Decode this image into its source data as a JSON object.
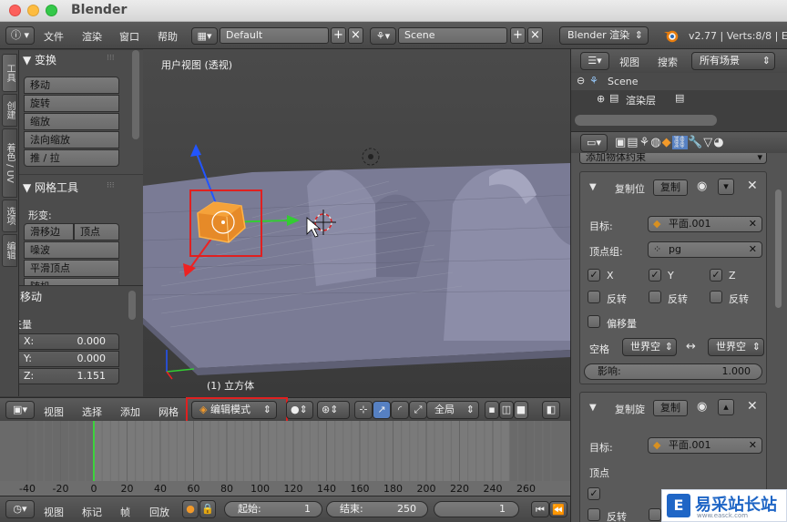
{
  "window": {
    "title": "Blender"
  },
  "topbar": {
    "menus": [
      "文件",
      "渲染",
      "窗口",
      "帮助"
    ],
    "layout": "Default",
    "scene": "Scene",
    "engine": "Blender 渲染",
    "stats": "v2.77 | Verts:8/8 | Ed"
  },
  "tabs": [
    "工具",
    "创建",
    "着色 / UV",
    "选项",
    "编辑"
  ],
  "shelf": {
    "transform_title": "变换",
    "transform_tools": [
      "移动",
      "旋转",
      "缩放",
      "法向缩放",
      "推 / 拉"
    ],
    "mesh_title": "网格工具",
    "deform_label": "形变:",
    "mesh_row1_a": "滑移边",
    "mesh_row1_b": "顶点",
    "mesh_tools": [
      "噪波",
      "平滑顶点",
      "随机"
    ],
    "op_title": "移动",
    "vector_label": "矢量",
    "x_label": "X:",
    "x_value": "0.000",
    "y_label": "Y:",
    "y_value": "0.000",
    "z_label": "Z:",
    "z_value": "1.151"
  },
  "viewport": {
    "view_label": "用户视图 (透视)",
    "object_label": "(1) 立方体"
  },
  "viewport_header": {
    "menus": [
      "视图",
      "选择",
      "添加",
      "网格"
    ],
    "mode": "编辑模式",
    "pivot": "全局"
  },
  "timeline": {
    "ruler": [
      "-40",
      "-20",
      "0",
      "20",
      "40",
      "60",
      "80",
      "100",
      "120",
      "140",
      "160",
      "180",
      "200",
      "220",
      "240",
      "260"
    ],
    "current_frame_marker": 0,
    "menus": [
      "视图",
      "标记",
      "帧",
      "回放"
    ],
    "start_label": "起始:",
    "start_value": "1",
    "end_label": "结束:",
    "end_value": "250",
    "current_value": "1"
  },
  "outliner": {
    "menus": [
      "视图",
      "搜索"
    ],
    "filter": "所有场景",
    "scene_item": "Scene",
    "layer_item": "渲染层"
  },
  "properties": {
    "add_constraint": "添加物体约束",
    "constraint1": {
      "name": "复制位",
      "copy_btn": "复制",
      "target_label": "目标:",
      "target_value": "平面.001",
      "vgroup_label": "顶点组:",
      "vgroup_value": "pg",
      "axes": [
        "X",
        "Y",
        "Z"
      ],
      "invert": [
        "反转",
        "反转",
        "反转"
      ],
      "offset_label": "偏移量",
      "space_label": "空格",
      "space_from": "世界空",
      "space_to": "世界空",
      "influence_label": "影响:",
      "influence_value": "1.000"
    },
    "constraint2": {
      "name": "复制旋",
      "copy_btn": "复制",
      "target_label": "目标:",
      "target_value": "平面.001",
      "vgroup_label": "顶点",
      "invert": "反转"
    }
  },
  "watermark": {
    "text": "易采站长站",
    "subtext": "www.easck.com"
  },
  "colors": {
    "selection_orange": "#f39a2a",
    "highlight_red": "#e02020",
    "frame_green": "#3cd23c"
  }
}
